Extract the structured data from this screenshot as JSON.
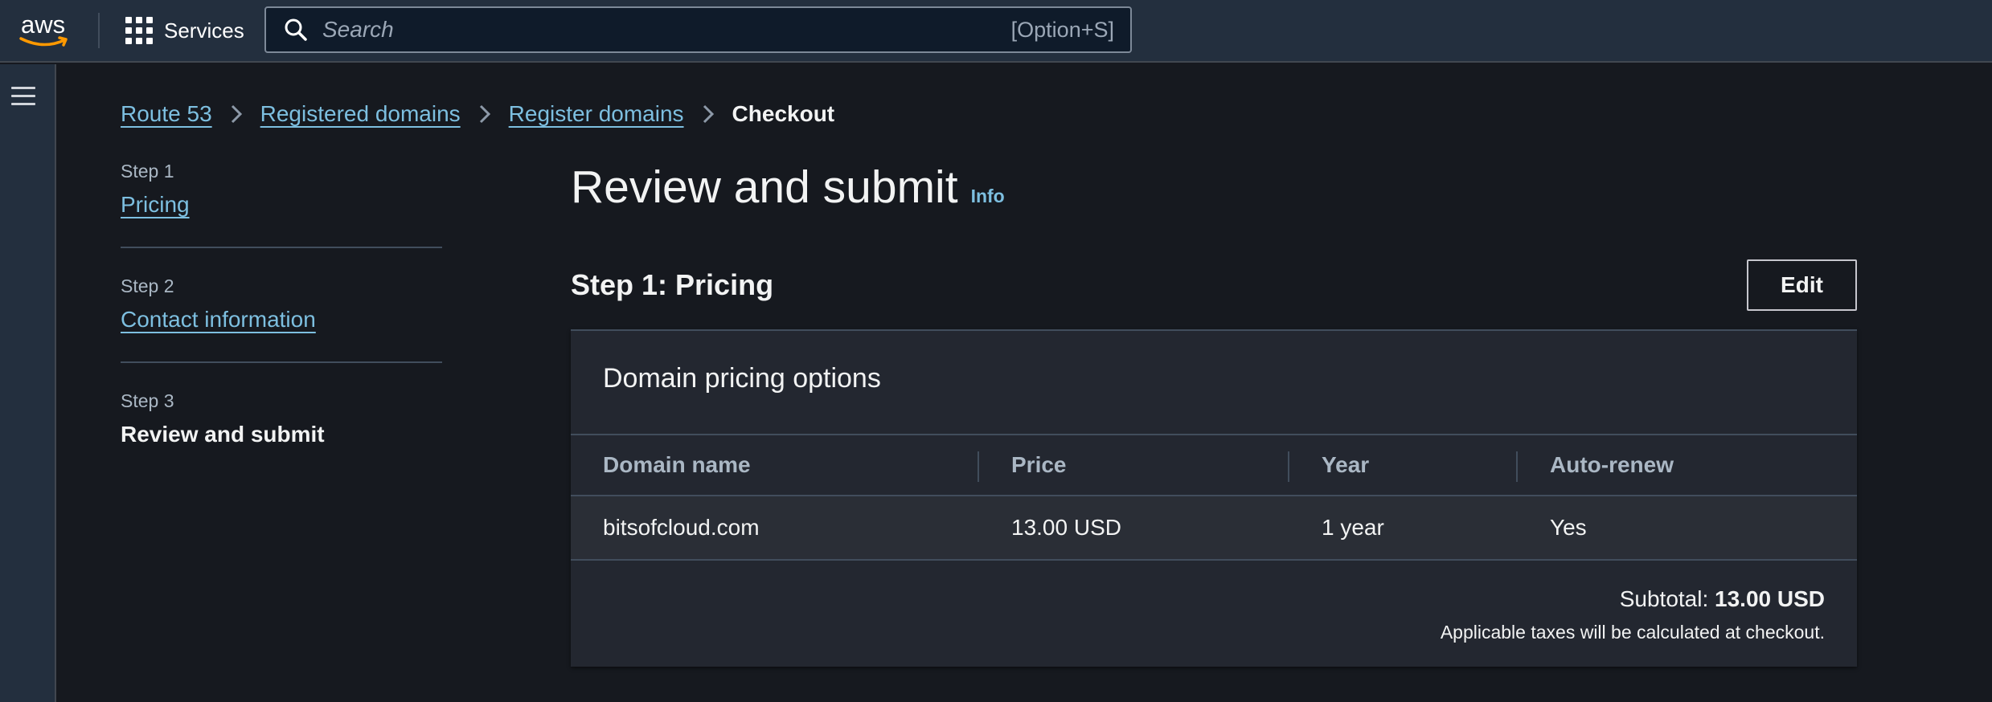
{
  "header": {
    "logo_text": "aws",
    "services_label": "Services",
    "search_placeholder": "Search",
    "search_shortcut": "[Option+S]"
  },
  "breadcrumb": {
    "items": [
      "Route 53",
      "Registered domains",
      "Register domains"
    ],
    "current": "Checkout"
  },
  "steps": [
    {
      "number": "Step 1",
      "label": "Pricing"
    },
    {
      "number": "Step 2",
      "label": "Contact information"
    },
    {
      "number": "Step 3",
      "label": "Review and submit"
    }
  ],
  "main": {
    "title": "Review and submit",
    "info_label": "Info",
    "section_title": "Step 1: Pricing",
    "edit_label": "Edit"
  },
  "pricing_card": {
    "title": "Domain pricing options",
    "columns": [
      "Domain name",
      "Price",
      "Year",
      "Auto-renew"
    ],
    "rows": [
      [
        "bitsofcloud.com",
        "13.00 USD",
        "1 year",
        "Yes"
      ]
    ],
    "subtotal_label": "Subtotal:",
    "subtotal_value": "13.00 USD",
    "tax_note": "Applicable taxes will be calculated at checkout."
  },
  "colors": {
    "header_bg": "#232f3e",
    "page_bg": "#16191f",
    "link": "#7dbfe0",
    "card_bg": "#232730"
  }
}
